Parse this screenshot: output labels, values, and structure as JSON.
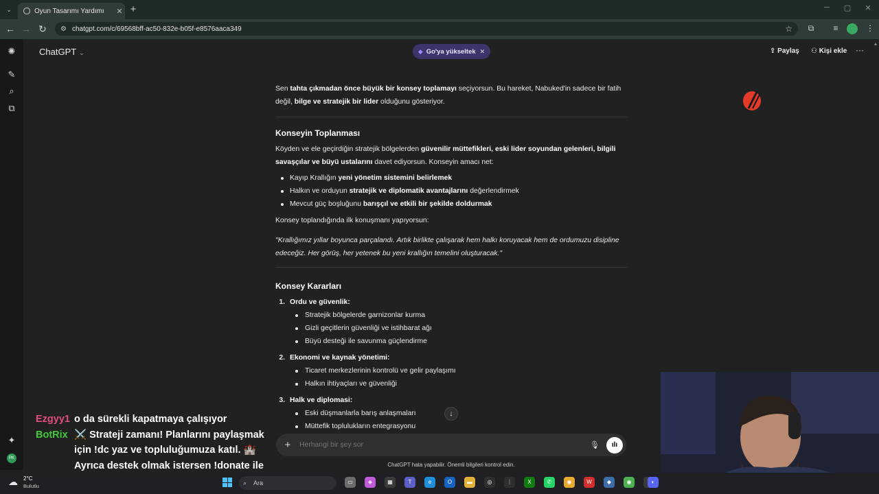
{
  "browser": {
    "tab_title": "Oyun Tasarımı Yardımı",
    "url": "chatgpt.com/c/69568bff-ac50-832e-b05f-e8576aaca349"
  },
  "header": {
    "title": "ChatGPT",
    "upgrade_label": "Go'ya yükseltek",
    "share_label": "Paylaş",
    "add_person_label": "Kişi ekle"
  },
  "conversation": {
    "p1": {
      "a": "Sen ",
      "b1": "tahta çıkmadan önce büyük bir konsey toplamayı",
      "c": " seçiyorsun. Bu hareket, Nabuked'in sadece bir fatih değil, ",
      "b2": "bilge ve stratejik bir lider",
      "d": " olduğunu gösteriyor."
    },
    "section1_title": "Konseyin Toplanması",
    "p2": {
      "a": "Köyden ve ele geçirdiğin stratejik bölgelerden ",
      "b1": "güvenilir müttefikleri, eski lider soyundan gelenleri, bilgili savaşçılar ve büyü ustalarını",
      "c": " davet ediyorsun. Konseyin amacı net:"
    },
    "bullets": [
      {
        "a": "Kayıp Krallığın ",
        "b": "yeni yönetim sistemini belirlemek",
        "c": ""
      },
      {
        "a": "Halkın ve orduyun ",
        "b": "stratejik ve diplomatik avantajlarını",
        "c": " değerlendirmek"
      },
      {
        "a": "Mevcut güç boşluğunu ",
        "b": "barışçıl ve etkili bir şekilde doldurmak",
        "c": ""
      }
    ],
    "p3": "Konsey toplandığında ilk konuşmanı yapıyorsun:",
    "quote": "\"Krallığımız yıllar boyunca parçalandı. Artık birlikte çalışarak hem halkı koruyacak hem de ordumuzu disipline edeceğiz. Her görüş, her yetenek bu yeni krallığın temelini oluşturacak.\"",
    "section2_title": "Konsey Kararları",
    "decisions": [
      {
        "num": "1.",
        "title": "Ordu ve güvenlik:",
        "items": [
          "Stratejik bölgelerde garnizonlar kurma",
          "Gizli geçitlerin güvenliği ve istihbarat ağı",
          "Büyü desteği ile savunma güçlendirme"
        ]
      },
      {
        "num": "2.",
        "title": "Ekonomi ve kaynak yönetimi:",
        "items": [
          "Ticaret merkezlerinin kontrolü ve gelir paylaşımı",
          "Halkın ihtiyaçları ve güvenliği"
        ]
      },
      {
        "num": "3.",
        "title": "Halk ve diplomasi:",
        "items": [
          "Eski düşmanlarla barış anlaşmaları",
          "Müttefik toplulukların entegrasyonu"
        ]
      }
    ]
  },
  "composer": {
    "placeholder": "Herhangi bir şey sor",
    "disclaimer": "ChatGPT hata yapabilir. Önemli bilgileri kontrol edin."
  },
  "stream_chat": [
    {
      "user": "Ezgyy1",
      "user_color": "#e0507a",
      "message": "o da sürekli kapatmaya çalışıyor"
    },
    {
      "user": "BotRix",
      "user_color": "#46c93c",
      "message": "⚔️ Strateji zamanı! Planlarını paylaşmak için !dc yaz ve topluluğumuza katıl. 🏰 Ayrıca destek olmak istersen !donate ile ekibimizi güçlendirebilirsin! 💎"
    }
  ],
  "taskbar": {
    "weather_temp": "2°C",
    "weather_cond": "Bulutlu",
    "search_label": "Ara"
  },
  "colors": {
    "background": "#212121",
    "accent_pill": "#3b3569",
    "browser_frame": "#1f2b26"
  }
}
